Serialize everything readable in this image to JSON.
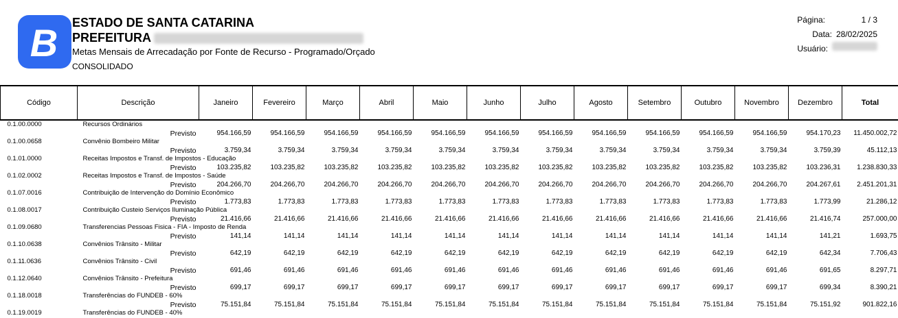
{
  "header": {
    "org_line1": "ESTADO DE SANTA CATARINA",
    "org_line2": "PREFEITURA",
    "report_title": "Metas Mensais de Arrecadação por Fonte de Recurso - Programado/Orçado",
    "scope": "CONSOLIDADO",
    "logo_letter": "B",
    "logo_color": "#2f6af0"
  },
  "meta": {
    "page_label": "Página:",
    "page_value": "1 /    3",
    "date_label": "Data:",
    "date_value": "28/02/2025",
    "user_label": "Usuário:"
  },
  "columns": [
    "Código",
    "Descrição",
    "Janeiro",
    "Fevereiro",
    "Março",
    "Abril",
    "Maio",
    "Junho",
    "Julho",
    "Agosto",
    "Setembro",
    "Outubro",
    "Novembro",
    "Dezembro",
    "Total"
  ],
  "rows": [
    {
      "code": "0.1.00.0000",
      "desc": "Recursos Ordinários",
      "label": "Previsto",
      "values": [
        "954.166,59",
        "954.166,59",
        "954.166,59",
        "954.166,59",
        "954.166,59",
        "954.166,59",
        "954.166,59",
        "954.166,59",
        "954.166,59",
        "954.166,59",
        "954.166,59",
        "954.170,23",
        "11.450.002,72"
      ]
    },
    {
      "code": "0.1.00.0658",
      "desc": "Convênio Bombeiro Militar",
      "label": "Previsto",
      "values": [
        "3.759,34",
        "3.759,34",
        "3.759,34",
        "3.759,34",
        "3.759,34",
        "3.759,34",
        "3.759,34",
        "3.759,34",
        "3.759,34",
        "3.759,34",
        "3.759,34",
        "3.759,39",
        "45.112,13"
      ]
    },
    {
      "code": "0.1.01.0000",
      "desc": "Receitas Impostos e Transf. de Impostos - Educação",
      "label": "Previsto",
      "values": [
        "103.235,82",
        "103.235,82",
        "103.235,82",
        "103.235,82",
        "103.235,82",
        "103.235,82",
        "103.235,82",
        "103.235,82",
        "103.235,82",
        "103.235,82",
        "103.235,82",
        "103.236,31",
        "1.238.830,33"
      ]
    },
    {
      "code": "0.1.02.0002",
      "desc": "Receitas Impostos e Transf. de Impostos - Saúde",
      "label": "Previsto",
      "values": [
        "204.266,70",
        "204.266,70",
        "204.266,70",
        "204.266,70",
        "204.266,70",
        "204.266,70",
        "204.266,70",
        "204.266,70",
        "204.266,70",
        "204.266,70",
        "204.266,70",
        "204.267,61",
        "2.451.201,31"
      ]
    },
    {
      "code": "0.1.07.0016",
      "desc": "Contribuição de Intervenção do Domínio Econômico",
      "label": "Previsto",
      "values": [
        "1.773,83",
        "1.773,83",
        "1.773,83",
        "1.773,83",
        "1.773,83",
        "1.773,83",
        "1.773,83",
        "1.773,83",
        "1.773,83",
        "1.773,83",
        "1.773,83",
        "1.773,99",
        "21.286,12"
      ]
    },
    {
      "code": "0.1.08.0017",
      "desc": "Contribuição Custeio Serviços Iluminação Pública",
      "label": "Previsto",
      "values": [
        "21.416,66",
        "21.416,66",
        "21.416,66",
        "21.416,66",
        "21.416,66",
        "21.416,66",
        "21.416,66",
        "21.416,66",
        "21.416,66",
        "21.416,66",
        "21.416,66",
        "21.416,74",
        "257.000,00"
      ]
    },
    {
      "code": "0.1.09.0680",
      "desc": "Transferencias Pessoas Fisica - FIA - Imposto de Renda",
      "label": "Previsto",
      "values": [
        "141,14",
        "141,14",
        "141,14",
        "141,14",
        "141,14",
        "141,14",
        "141,14",
        "141,14",
        "141,14",
        "141,14",
        "141,14",
        "141,21",
        "1.693,75"
      ]
    },
    {
      "code": "0.1.10.0638",
      "desc": "Convênios Trânsito - Militar",
      "label": "Previsto",
      "values": [
        "642,19",
        "642,19",
        "642,19",
        "642,19",
        "642,19",
        "642,19",
        "642,19",
        "642,19",
        "642,19",
        "642,19",
        "642,19",
        "642,34",
        "7.706,43"
      ]
    },
    {
      "code": "0.1.11.0636",
      "desc": "Convênios Trânsito - Civil",
      "label": "Previsto",
      "values": [
        "691,46",
        "691,46",
        "691,46",
        "691,46",
        "691,46",
        "691,46",
        "691,46",
        "691,46",
        "691,46",
        "691,46",
        "691,46",
        "691,65",
        "8.297,71"
      ]
    },
    {
      "code": "0.1.12.0640",
      "desc": "Convênios Trânsito - Prefeitura",
      "label": "Previsto",
      "values": [
        "699,17",
        "699,17",
        "699,17",
        "699,17",
        "699,17",
        "699,17",
        "699,17",
        "699,17",
        "699,17",
        "699,17",
        "699,17",
        "699,34",
        "8.390,21"
      ]
    },
    {
      "code": "0.1.18.0018",
      "desc": "Transferências do FUNDEB - 60%",
      "label": "Previsto",
      "values": [
        "75.151,84",
        "75.151,84",
        "75.151,84",
        "75.151,84",
        "75.151,84",
        "75.151,84",
        "75.151,84",
        "75.151,84",
        "75.151,84",
        "75.151,84",
        "75.151,84",
        "75.151,92",
        "901.822,16"
      ]
    },
    {
      "code": "0.1.19.0019",
      "desc": "Transferências do FUNDEB - 40%",
      "label": "",
      "values": []
    }
  ]
}
